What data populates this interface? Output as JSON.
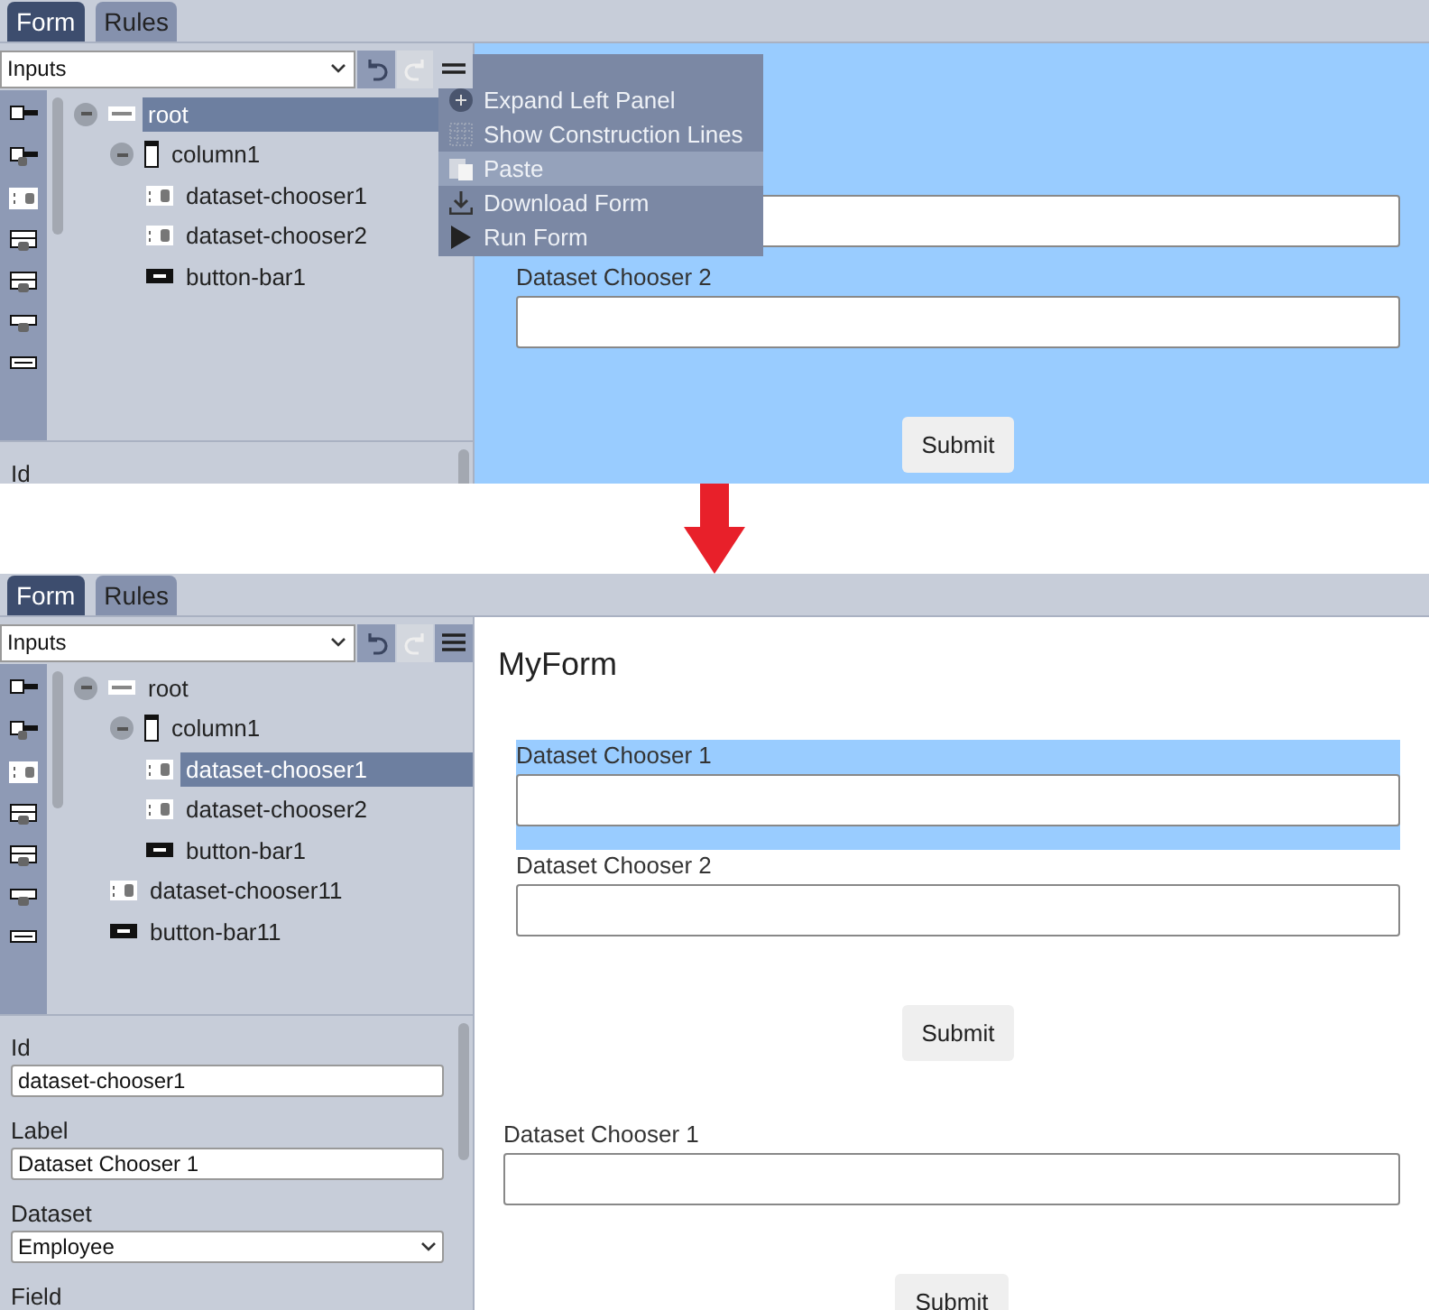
{
  "screens": [
    {
      "tabs": [
        {
          "label": "Form",
          "selected": true
        },
        {
          "label": "Rules",
          "selected": false
        }
      ],
      "toolbar": {
        "palette": "Inputs",
        "undo_enabled": true,
        "redo_enabled": false,
        "menu_open": true
      },
      "palette_icons": [
        {
          "kind": "checkbox"
        },
        {
          "kind": "checkbox-db"
        },
        {
          "kind": "chooser"
        },
        {
          "kind": "list"
        },
        {
          "kind": "list"
        },
        {
          "kind": "combo"
        },
        {
          "kind": "button"
        }
      ],
      "tree": [
        {
          "label": "root",
          "kind": "form",
          "selected": true,
          "expanded": true,
          "children": [
            {
              "label": "column1",
              "kind": "column",
              "selected": false,
              "expanded": true,
              "children": [
                {
                  "label": "dataset-chooser1",
                  "kind": "chooser",
                  "selected": false
                },
                {
                  "label": "dataset-chooser2",
                  "kind": "chooser",
                  "selected": false
                },
                {
                  "label": "button-bar1",
                  "kind": "button",
                  "selected": false
                }
              ]
            }
          ]
        }
      ],
      "properties": [
        {
          "label": "Id",
          "kind": "text"
        }
      ],
      "menu": [
        {
          "label": "Expand Left Panel",
          "kind": "plus",
          "hovered": false
        },
        {
          "label": "Show Construction Lines",
          "kind": "grid",
          "hovered": false
        },
        {
          "label": "Paste",
          "kind": "paste",
          "hovered": true
        },
        {
          "label": "Download Form",
          "kind": "download",
          "hovered": false
        },
        {
          "label": "Run Form",
          "kind": "play",
          "hovered": false
        }
      ],
      "canvas": {
        "selected": true,
        "groups": [
          {
            "elements": [
              {
                "kind": "chooser",
                "selected": false
              },
              {
                "kind": "chooser",
                "label": "Dataset Chooser 2",
                "selected": false
              },
              {
                "kind": "button",
                "label": "Submit"
              }
            ]
          }
        ]
      }
    },
    {
      "tabs": [
        {
          "label": "Form",
          "selected": true
        },
        {
          "label": "Rules",
          "selected": false
        }
      ],
      "toolbar": {
        "palette": "Inputs",
        "undo_enabled": true,
        "redo_enabled": false,
        "menu_open": false
      },
      "palette_icons": [
        {
          "kind": "checkbox"
        },
        {
          "kind": "checkbox-db"
        },
        {
          "kind": "chooser"
        },
        {
          "kind": "list"
        },
        {
          "kind": "list"
        },
        {
          "kind": "combo"
        },
        {
          "kind": "button"
        }
      ],
      "tree": [
        {
          "label": "root",
          "kind": "form",
          "selected": false,
          "expanded": true,
          "children": [
            {
              "label": "column1",
              "kind": "column",
              "selected": false,
              "expanded": true,
              "children": [
                {
                  "label": "dataset-chooser1",
                  "kind": "chooser",
                  "selected": true
                },
                {
                  "label": "dataset-chooser2",
                  "kind": "chooser",
                  "selected": false
                },
                {
                  "label": "button-bar1",
                  "kind": "button",
                  "selected": false
                }
              ]
            },
            {
              "label": "dataset-chooser11",
              "kind": "chooser",
              "selected": false
            },
            {
              "label": "button-bar11",
              "kind": "button",
              "selected": false
            }
          ]
        }
      ],
      "properties": [
        {
          "label": "Id",
          "kind": "text",
          "value": "dataset-chooser1"
        },
        {
          "label": "Label",
          "kind": "text",
          "value": "Dataset Chooser 1"
        },
        {
          "label": "Dataset",
          "kind": "select",
          "value": "Employee"
        },
        {
          "label": "Field",
          "kind": "text"
        }
      ],
      "canvas": {
        "selected": false,
        "title": "MyForm",
        "groups": [
          {
            "elements": [
              {
                "kind": "chooser",
                "label": "Dataset Chooser 1",
                "selected": true
              },
              {
                "kind": "chooser",
                "label": "Dataset Chooser 2",
                "selected": false
              },
              {
                "kind": "button",
                "label": "Submit"
              }
            ]
          },
          {
            "elements": [
              {
                "kind": "chooser",
                "label": "Dataset Chooser 1",
                "selected": false
              },
              {
                "kind": "button",
                "label": "Submit"
              }
            ]
          }
        ]
      }
    }
  ]
}
